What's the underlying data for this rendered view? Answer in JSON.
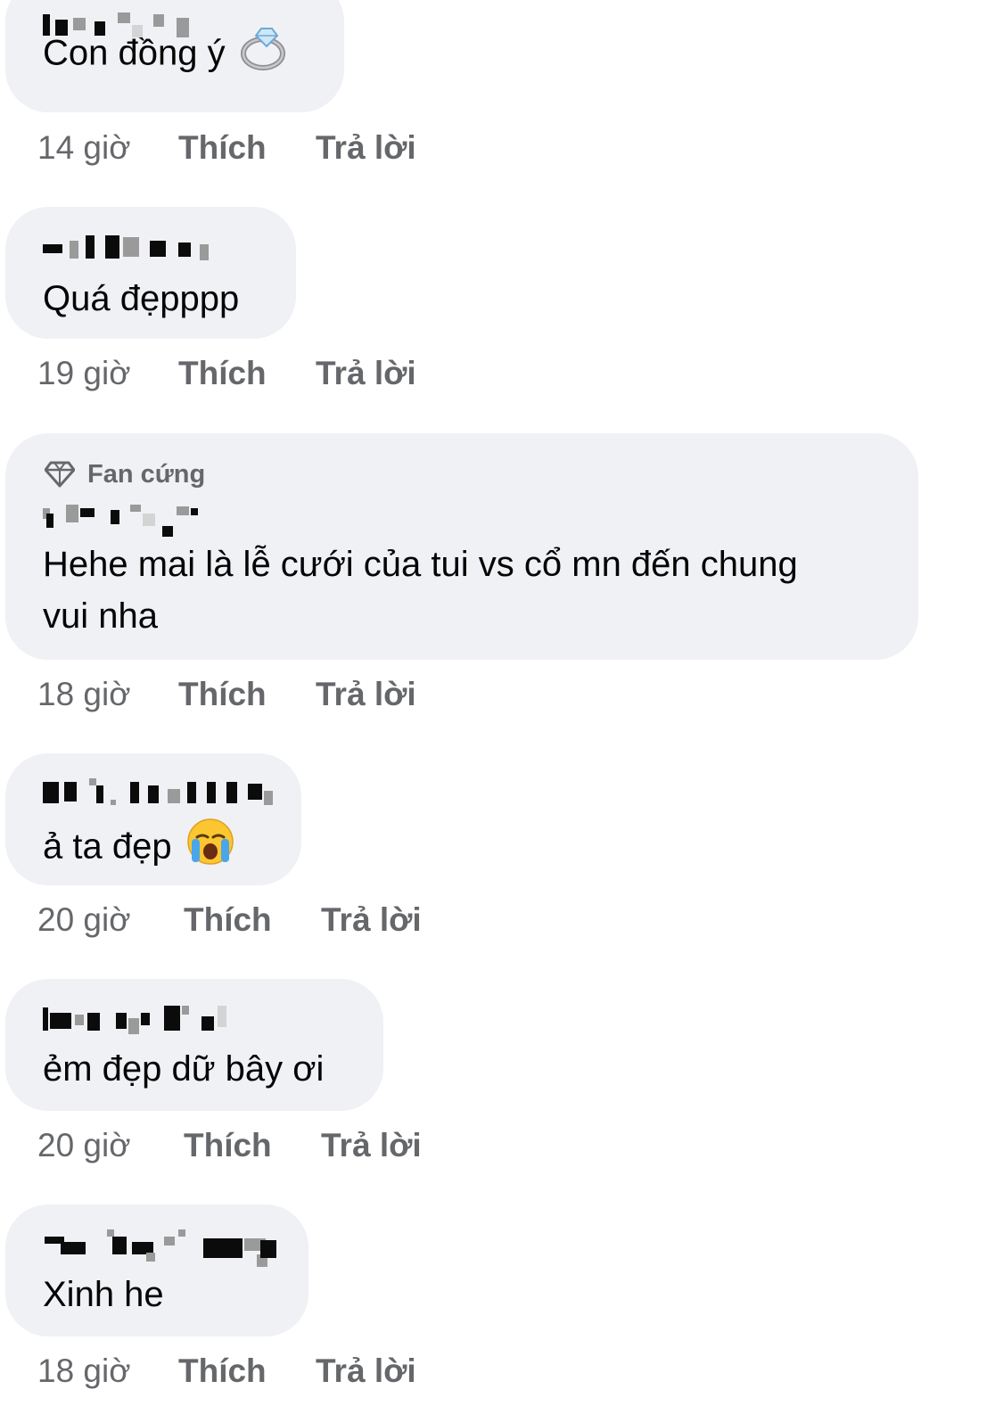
{
  "comments": [
    {
      "text": "Con đồng ý",
      "emoji": "ring-icon",
      "time": "14 giờ",
      "like": "Thích",
      "reply": "Trả lời"
    },
    {
      "text": "Quá đẹpppp",
      "time": "19 giờ",
      "like": "Thích",
      "reply": "Trả lời"
    },
    {
      "badge": "Fan cứng",
      "badge_icon": "diamond-icon",
      "text_line1": "Hehe mai là lễ cưới của tui vs cổ mn đến chung",
      "text_line2": "vui nha",
      "time": "18 giờ",
      "like": "Thích",
      "reply": "Trả lời"
    },
    {
      "text": "ả ta đẹp",
      "emoji": "crying-face-icon",
      "time": "20 giờ",
      "like": "Thích",
      "reply": "Trả lời"
    },
    {
      "text": "ẻm đẹp dữ bây ơi",
      "time": "20 giờ",
      "like": "Thích",
      "reply": "Trả lời"
    },
    {
      "text": "Xinh he",
      "time": "18 giờ",
      "like": "Thích",
      "reply": "Trả lời"
    }
  ],
  "colors": {
    "bubble": "#f0f1f5",
    "secondary_text": "#65676b",
    "primary_text": "#050505"
  }
}
